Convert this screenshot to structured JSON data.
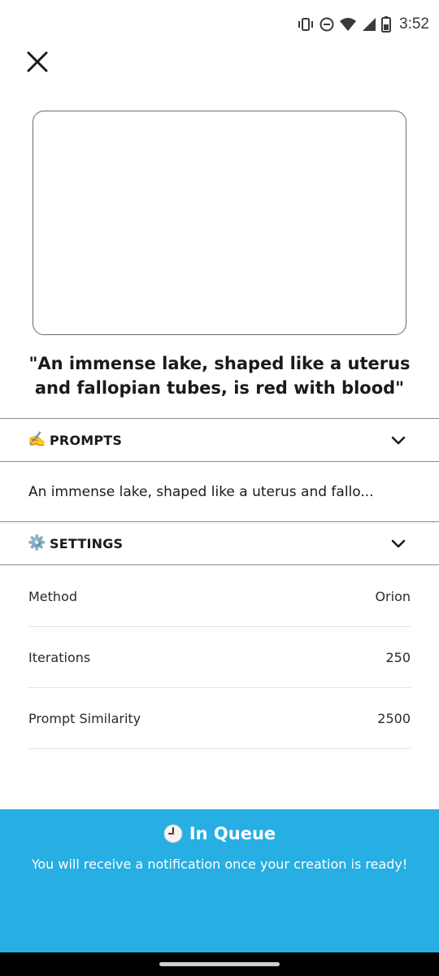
{
  "status_bar": {
    "time": "3:52",
    "icons": [
      "vibrate-icon",
      "do-not-disturb-icon",
      "wifi-icon",
      "signal-icon",
      "battery-icon"
    ]
  },
  "close_icon": "close-icon",
  "creation": {
    "title": "\"An immense lake, shaped like a uterus and fallopian tubes, is red with blood\""
  },
  "prompts_section": {
    "emoji": "✍️",
    "label": "PROMPTS",
    "prompt_text": "An immense lake, shaped like a uterus and fallo..."
  },
  "settings_section": {
    "emoji": "⚙️",
    "label": "SETTINGS",
    "rows": [
      {
        "label": "Method",
        "value": "Orion"
      },
      {
        "label": "Iterations",
        "value": "250"
      },
      {
        "label": "Prompt Similarity",
        "value": "2500"
      }
    ]
  },
  "queue_banner": {
    "title": "In Queue",
    "message": "You will receive a notification once your creation is ready!",
    "background_color": "#27aee3"
  }
}
